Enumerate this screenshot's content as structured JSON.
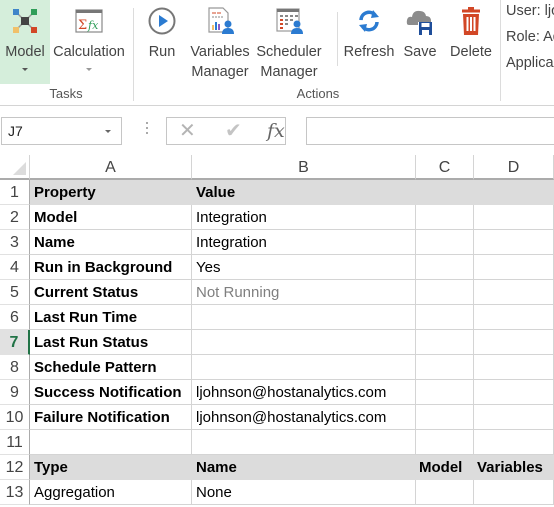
{
  "ribbon": {
    "tasks_group": {
      "label": "Tasks",
      "buttons": [
        {
          "id": "model",
          "label": "Model",
          "icon": "model-icon",
          "has_dropdown": true,
          "active": true
        },
        {
          "id": "calculation",
          "label": "Calculation",
          "icon": "calculation-icon",
          "has_dropdown": true
        }
      ]
    },
    "actions_group": {
      "label": "Actions",
      "buttons": [
        {
          "id": "run",
          "label": "Run",
          "icon": "play-icon"
        },
        {
          "id": "variables-manager",
          "label_line1": "Variables",
          "label_line2": "Manager",
          "icon": "variables-manager-icon"
        },
        {
          "id": "scheduler-manager",
          "label_line1": "Scheduler",
          "label_line2": "Manager",
          "icon": "scheduler-manager-icon"
        },
        {
          "id": "refresh",
          "label": "Refresh",
          "icon": "refresh-icon"
        },
        {
          "id": "save",
          "label": "Save",
          "icon": "cloud-save-icon"
        },
        {
          "id": "delete",
          "label": "Delete",
          "icon": "trash-icon"
        }
      ]
    },
    "info": {
      "user": "User: ljo",
      "role": "Role: Ad",
      "application": "Applica"
    }
  },
  "formula_bar": {
    "name_box": "J7",
    "cancel_icon": "✕",
    "enter_icon": "✔",
    "fx_label": "fx",
    "formula": ""
  },
  "columns": [
    "A",
    "B",
    "C",
    "D"
  ],
  "selected_row": 7,
  "rows": [
    {
      "num": "1",
      "cells": [
        "Property",
        "Value",
        "",
        ""
      ],
      "style": "header"
    },
    {
      "num": "2",
      "cells": [
        "Model",
        "Integration",
        "",
        ""
      ]
    },
    {
      "num": "3",
      "cells": [
        "Name",
        "Integration",
        "",
        ""
      ]
    },
    {
      "num": "4",
      "cells": [
        "Run in Background",
        "Yes",
        "",
        ""
      ]
    },
    {
      "num": "5",
      "cells": [
        "Current Status",
        "Not Running",
        "",
        ""
      ]
    },
    {
      "num": "6",
      "cells": [
        "Last Run Time",
        "",
        "",
        ""
      ]
    },
    {
      "num": "7",
      "cells": [
        "Last Run Status",
        "",
        "",
        ""
      ]
    },
    {
      "num": "8",
      "cells": [
        "Schedule Pattern",
        "",
        "",
        ""
      ]
    },
    {
      "num": "9",
      "cells": [
        "Success Notification",
        "ljohnson@hostanalytics.com",
        "",
        ""
      ]
    },
    {
      "num": "10",
      "cells": [
        "Failure Notification",
        "ljohnson@hostanalytics.com",
        "",
        ""
      ]
    },
    {
      "num": "11",
      "cells": [
        "",
        "",
        "",
        ""
      ]
    },
    {
      "num": "12",
      "cells": [
        "Type",
        "Name",
        "Model",
        "Variables"
      ],
      "style": "header"
    },
    {
      "num": "13",
      "cells": [
        "Aggregation",
        "None",
        "",
        ""
      ]
    }
  ],
  "colors": {
    "active_button_bg": "#d5eedb",
    "selection_green": "#217346",
    "header_row_bg": "#dcdcdc",
    "delete_red": "#d24726",
    "icon_blue": "#2b7bd1"
  }
}
